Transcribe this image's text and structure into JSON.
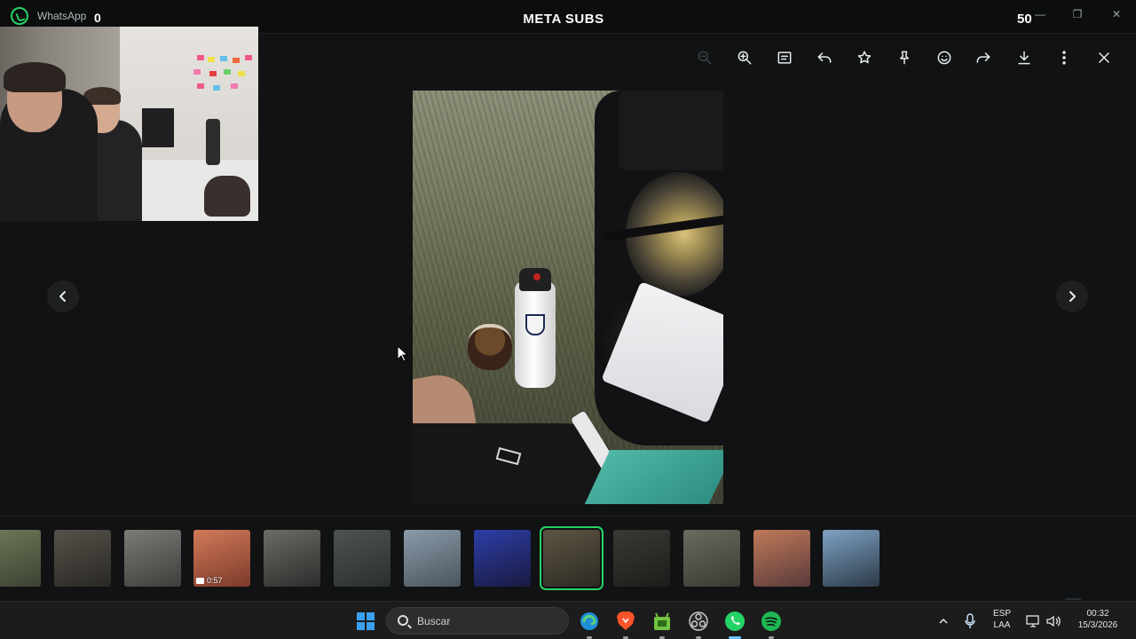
{
  "titlebar": {
    "app_name": "WhatsApp",
    "counter_left": "0",
    "stream_title": "META SUBS",
    "counter_right": "50",
    "minimize": "—",
    "restore": "❐",
    "close": "✕"
  },
  "toolbar": {
    "icons": [
      "zoom-out-icon",
      "zoom-in-icon",
      "message-icon",
      "reply-icon",
      "star-icon",
      "pin-icon",
      "emoji-icon",
      "forward-icon",
      "download-icon",
      "more-icon",
      "close-icon"
    ]
  },
  "thumbnails": [
    {
      "colors": [
        "#6f7a5a",
        "#3d4232"
      ]
    },
    {
      "colors": [
        "#55524a",
        "#2a2824"
      ]
    },
    {
      "colors": [
        "#7a7d76",
        "#3c3e3a"
      ]
    },
    {
      "colors": [
        "#d27a5a",
        "#7c3a2a"
      ],
      "duration": "0:57"
    },
    {
      "colors": [
        "#6a6c66",
        "#2c2d2b"
      ]
    },
    {
      "colors": [
        "#4c5352",
        "#2b302f"
      ]
    },
    {
      "colors": [
        "#8a9aa8",
        "#4a5660"
      ]
    },
    {
      "colors": [
        "#2d3ea8",
        "#1a1a40"
      ]
    },
    {
      "colors": [
        "#5d5543",
        "#2c2a23"
      ],
      "active": true
    },
    {
      "colors": [
        "#3a3a34",
        "#1c1c1a"
      ]
    },
    {
      "colors": [
        "#6a6a60",
        "#3a3a32"
      ]
    },
    {
      "colors": [
        "#c07a5a",
        "#5a3a3a"
      ]
    },
    {
      "colors": [
        "#7fa2c4",
        "#2c3a48"
      ]
    }
  ],
  "taskbar": {
    "search_placeholder": "Buscar",
    "language_line1": "ESP",
    "language_line2": "LAA",
    "time": "00:32",
    "date": "15/3/2026",
    "accent": "#6cc4ff"
  }
}
